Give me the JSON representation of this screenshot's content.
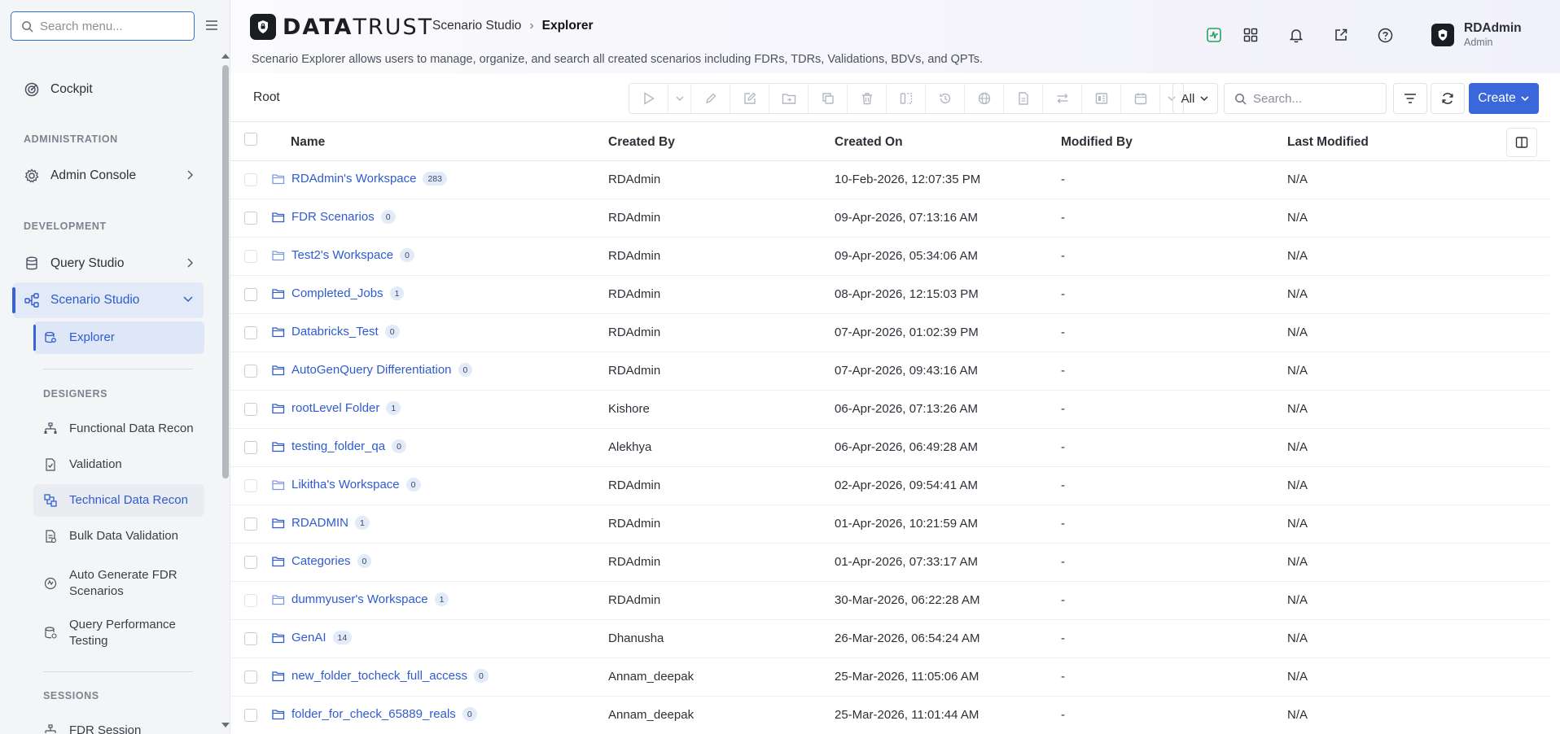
{
  "colors": {
    "accent": "#3a67d9",
    "link": "#2f5bd0",
    "sidebar_bg": "#f4f5f7",
    "active_bg": "#e2e9f7",
    "status_green": "#21a35a"
  },
  "sidebar": {
    "search_placeholder": "Search menu...",
    "cockpit_label": "Cockpit",
    "section_admin": "ADMINISTRATION",
    "admin_console_label": "Admin Console",
    "section_dev": "DEVELOPMENT",
    "query_studio_label": "Query Studio",
    "scenario_studio_label": "Scenario Studio",
    "explorer_label": "Explorer",
    "section_designers": "DESIGNERS",
    "designers": [
      {
        "label": "Functional Data Recon",
        "icon": "hierarchy-icon"
      },
      {
        "label": "Validation",
        "icon": "file-check-icon"
      },
      {
        "label": "Technical Data Recon",
        "icon": "tdr-icon"
      },
      {
        "label": "Bulk Data Validation",
        "icon": "bulk-file-icon"
      },
      {
        "label": "Auto Generate FDR Scenarios",
        "icon": "auto-generate-icon"
      },
      {
        "label": "Query Performance Testing",
        "icon": "database-gauge-icon"
      }
    ],
    "section_sessions": "SESSIONS",
    "sessions": [
      {
        "label": "FDR Session",
        "icon": "session-icon"
      }
    ]
  },
  "header": {
    "brand_bold": "DATA",
    "brand_light": "TRUST",
    "breadcrumb": [
      "Scenario Studio",
      "Explorer"
    ],
    "description": "Scenario Explorer allows users to manage, organize, and search all created scenarios including FDRs, TDRs, Validations, BDVs, and QPTs.",
    "user_name": "RDAdmin",
    "user_role": "Admin"
  },
  "toolbar": {
    "root_label": "Root",
    "filter_value": "All",
    "search_placeholder": "Search...",
    "create_label": "Create"
  },
  "table": {
    "columns": [
      "Name",
      "Created By",
      "Created On",
      "Modified By",
      "Last Modified"
    ],
    "rows": [
      {
        "name": "RDAdmin's Workspace",
        "count": "283",
        "created_by": "RDAdmin",
        "created_on": "10-Feb-2026, 12:07:35 PM",
        "modified_by": "-",
        "last_modified": "N/A",
        "workspace": true
      },
      {
        "name": "FDR Scenarios",
        "count": "0",
        "created_by": "RDAdmin",
        "created_on": "09-Apr-2026, 07:13:16 AM",
        "modified_by": "-",
        "last_modified": "N/A",
        "workspace": false
      },
      {
        "name": "Test2's Workspace",
        "count": "0",
        "created_by": "RDAdmin",
        "created_on": "09-Apr-2026, 05:34:06 AM",
        "modified_by": "-",
        "last_modified": "N/A",
        "workspace": true
      },
      {
        "name": "Completed_Jobs",
        "count": "1",
        "created_by": "RDAdmin",
        "created_on": "08-Apr-2026, 12:15:03 PM",
        "modified_by": "-",
        "last_modified": "N/A",
        "workspace": false
      },
      {
        "name": "Databricks_Test",
        "count": "0",
        "created_by": "RDAdmin",
        "created_on": "07-Apr-2026, 01:02:39 PM",
        "modified_by": "-",
        "last_modified": "N/A",
        "workspace": false
      },
      {
        "name": "AutoGenQuery Differentiation",
        "count": "0",
        "created_by": "RDAdmin",
        "created_on": "07-Apr-2026, 09:43:16 AM",
        "modified_by": "-",
        "last_modified": "N/A",
        "workspace": false
      },
      {
        "name": "rootLevel Folder",
        "count": "1",
        "created_by": "Kishore",
        "created_on": "06-Apr-2026, 07:13:26 AM",
        "modified_by": "-",
        "last_modified": "N/A",
        "workspace": false
      },
      {
        "name": "testing_folder_qa",
        "count": "0",
        "created_by": "Alekhya",
        "created_on": "06-Apr-2026, 06:49:28 AM",
        "modified_by": "-",
        "last_modified": "N/A",
        "workspace": false
      },
      {
        "name": "Likitha's Workspace",
        "count": "0",
        "created_by": "RDAdmin",
        "created_on": "02-Apr-2026, 09:54:41 AM",
        "modified_by": "-",
        "last_modified": "N/A",
        "workspace": true
      },
      {
        "name": "RDADMIN",
        "count": "1",
        "created_by": "RDAdmin",
        "created_on": "01-Apr-2026, 10:21:59 AM",
        "modified_by": "-",
        "last_modified": "N/A",
        "workspace": false
      },
      {
        "name": "Categories",
        "count": "0",
        "created_by": "RDAdmin",
        "created_on": "01-Apr-2026, 07:33:17 AM",
        "modified_by": "-",
        "last_modified": "N/A",
        "workspace": false
      },
      {
        "name": "dummyuser's Workspace",
        "count": "1",
        "created_by": "RDAdmin",
        "created_on": "30-Mar-2026, 06:22:28 AM",
        "modified_by": "-",
        "last_modified": "N/A",
        "workspace": true
      },
      {
        "name": "GenAI",
        "count": "14",
        "created_by": "Dhanusha",
        "created_on": "26-Mar-2026, 06:54:24 AM",
        "modified_by": "-",
        "last_modified": "N/A",
        "workspace": false
      },
      {
        "name": "new_folder_tocheck_full_access",
        "count": "0",
        "created_by": "Annam_deepak",
        "created_on": "25-Mar-2026, 11:05:06 AM",
        "modified_by": "-",
        "last_modified": "N/A",
        "workspace": false
      },
      {
        "name": "folder_for_check_65889_reals",
        "count": "0",
        "created_by": "Annam_deepak",
        "created_on": "25-Mar-2026, 11:01:44 AM",
        "modified_by": "-",
        "last_modified": "N/A",
        "workspace": false
      }
    ]
  }
}
